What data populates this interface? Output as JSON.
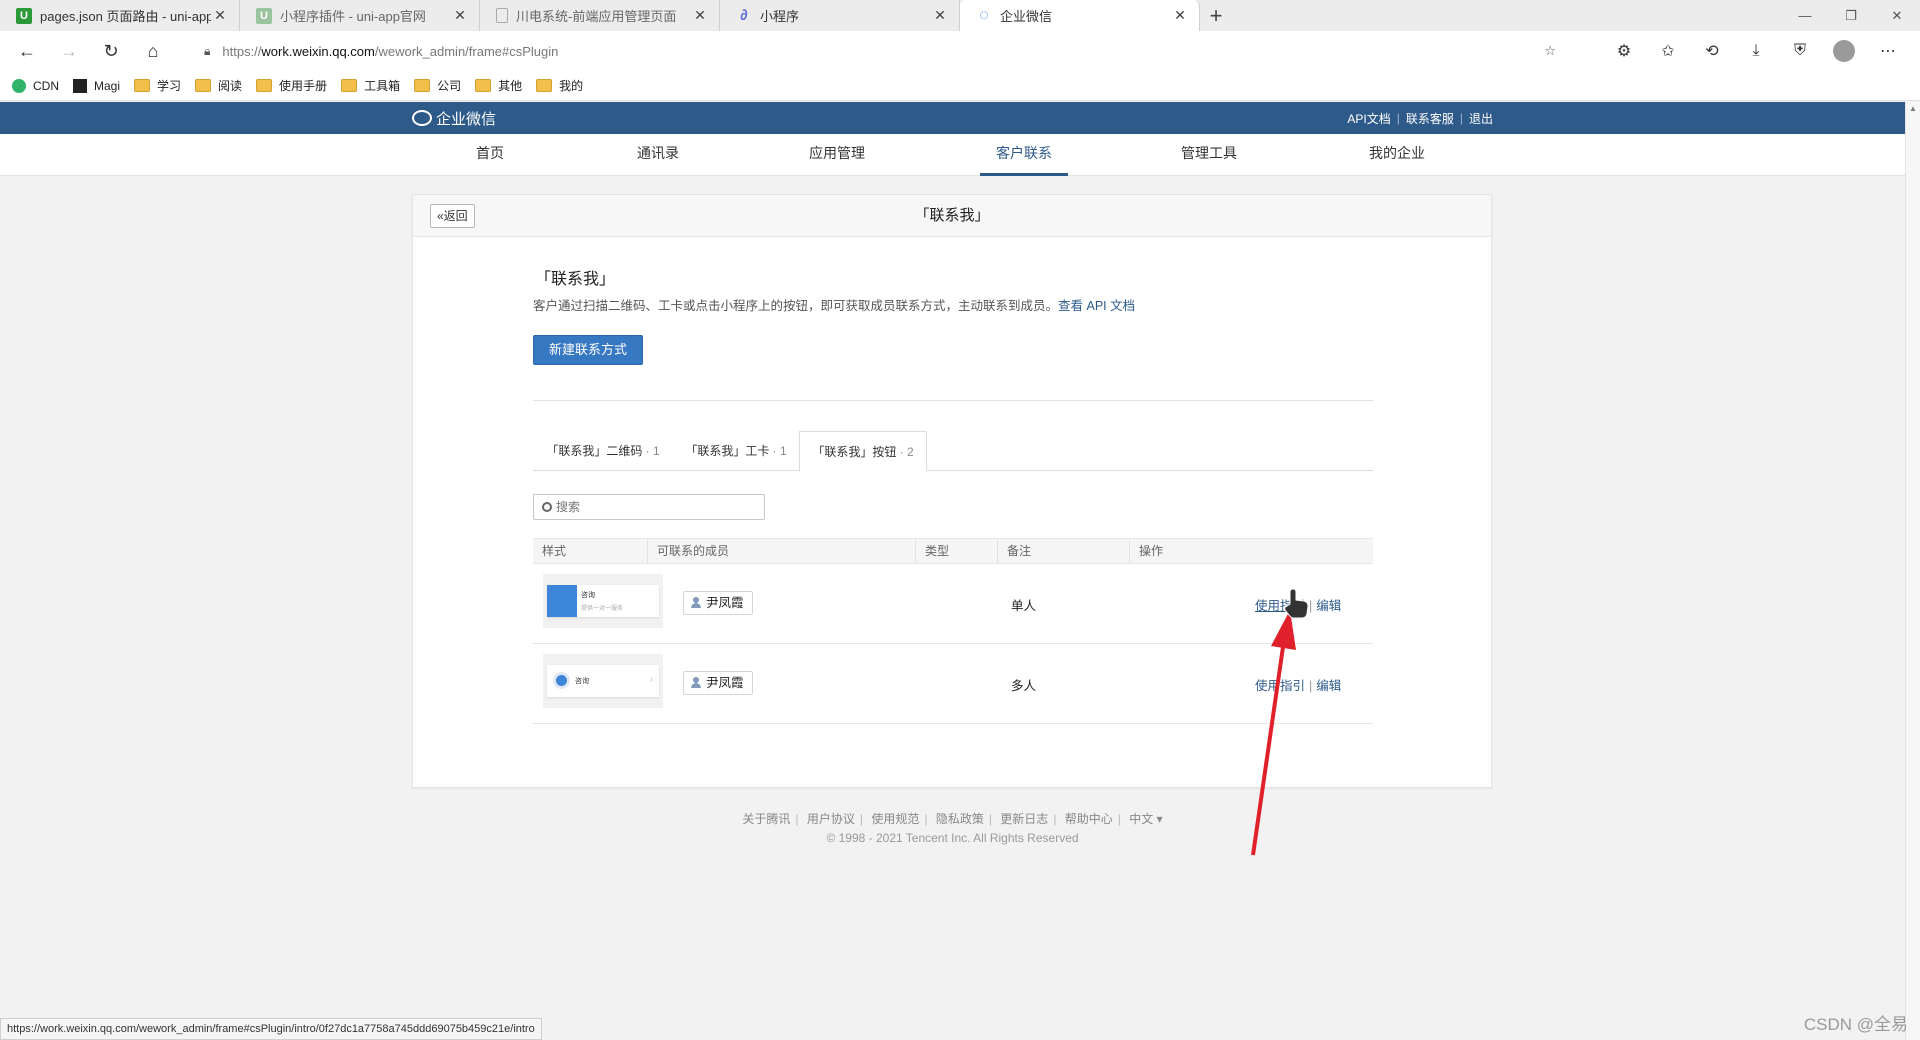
{
  "browser": {
    "tabs": [
      {
        "title": "pages.json 页面路由 - uni-app官",
        "fav": "U",
        "fav_color": "#2b9939"
      },
      {
        "title": "小程序插件 - uni-app官网",
        "fav": "U",
        "fav_color": "#9ac39e"
      },
      {
        "title": "川电系统-前端应用管理页面",
        "fav": "",
        "fav_color": "#cccccc"
      },
      {
        "title": "小程序",
        "fav": "∂",
        "fav_color": "#5a6dd8"
      },
      {
        "title": "企业微信",
        "fav": "◌",
        "fav_color": "#2e7fd9",
        "active": true
      }
    ],
    "url_prefix": "https://",
    "url_host": "work.weixin.qq.com",
    "url_path": "/wework_admin/frame#csPlugin",
    "bookmarks": [
      {
        "label": "CDN",
        "icon": "cdn"
      },
      {
        "label": "Magi",
        "icon": "magi"
      },
      {
        "label": "学习",
        "icon": "folder"
      },
      {
        "label": "阅读",
        "icon": "folder"
      },
      {
        "label": "使用手册",
        "icon": "folder"
      },
      {
        "label": "工具箱",
        "icon": "folder"
      },
      {
        "label": "公司",
        "icon": "folder"
      },
      {
        "label": "其他",
        "icon": "folder"
      },
      {
        "label": "我的",
        "icon": "folder"
      }
    ]
  },
  "wework": {
    "brand": "企业微信",
    "top_links": [
      "API文档",
      "联系客服",
      "退出"
    ],
    "nav": [
      {
        "label": "首页"
      },
      {
        "label": "通讯录"
      },
      {
        "label": "应用管理"
      },
      {
        "label": "客户联系",
        "active": true
      },
      {
        "label": "管理工具"
      },
      {
        "label": "我的企业"
      }
    ],
    "back": "«返回",
    "page_title": "「联系我」",
    "intro_title": "「联系我」",
    "intro_desc": "客户通过扫描二维码、工卡或点击小程序上的按钮，即可获取成员联系方式，主动联系到成员。",
    "intro_link": "查看 API 文档",
    "new_button": "新建联系方式",
    "tabs": [
      {
        "label": "「联系我」二维码",
        "count": " · 1"
      },
      {
        "label": "「联系我」工卡",
        "count": " · 1"
      },
      {
        "label": "「联系我」按钮",
        "count": " · 2",
        "active": true
      }
    ],
    "search_placeholder": "搜索",
    "table": {
      "headers": [
        "样式",
        "可联系的成员",
        "类型",
        "备注",
        "操作"
      ],
      "rows": [
        {
          "style": "single",
          "thumb_title": "咨询",
          "thumb_sub": "提供一对一服务",
          "member": "尹凤霞",
          "type": "单人",
          "remark": "",
          "op_guide": "使用指引",
          "op_edit": "编辑"
        },
        {
          "style": "multi",
          "thumb_title": "咨询",
          "thumb_sub": "",
          "member": "尹凤霞",
          "type": "多人",
          "remark": "",
          "op_guide": "使用指引",
          "op_edit": "编辑"
        }
      ]
    },
    "footer_links": [
      "关于腾讯",
      "用户协议",
      "使用规范",
      "隐私政策",
      "更新日志",
      "帮助中心",
      "中文 ▾"
    ],
    "copyright": "© 1998 - 2021 Tencent Inc. All Rights Reserved"
  },
  "status_url": "https://work.weixin.qq.com/wework_admin/frame#csPlugin/intro/0f27dc1a7758a745ddd69075b459c21e/intro",
  "watermark": "CSDN @全易",
  "colors": {
    "header_bg": "#2e5a8a",
    "primary": "#3778c2",
    "link": "#2e5a8a",
    "arrow": "#e0202a"
  }
}
